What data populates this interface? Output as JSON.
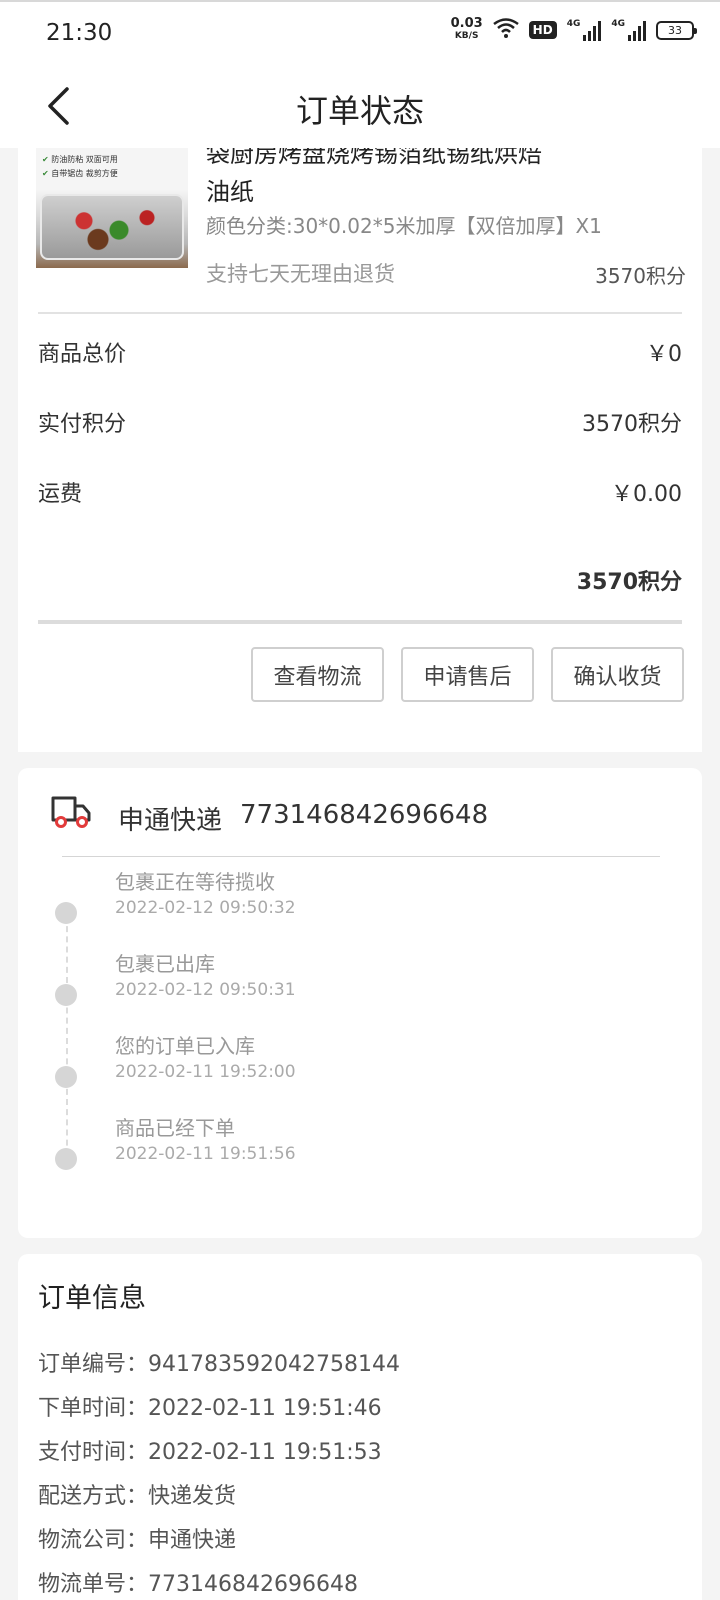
{
  "status_bar": {
    "time": "21:30",
    "speed_value": "0.03",
    "speed_unit": "KB/S",
    "hd": "HD",
    "net1": "4G",
    "net2": "4G",
    "battery": "33"
  },
  "header": {
    "title": "订单状态"
  },
  "product": {
    "name_line1": "袋厨房烤盘烧烤锡箔纸锡纸烘焙",
    "name_line2": "油纸",
    "spec": "颜色分类:30*0.02*5米加厚【双倍加厚】X1",
    "return_policy": "支持七天无理由退货",
    "points": "3570积分",
    "image_features": [
      "防油防粘 双面可用",
      "自带锯齿 裁剪方便"
    ]
  },
  "summary": {
    "goods_total_label": "商品总价",
    "goods_total_value": "￥0",
    "paid_points_label": "实付积分",
    "paid_points_value": "3570积分",
    "shipping_label": "运费",
    "shipping_value": "￥0.00",
    "total": "3570积分"
  },
  "actions": {
    "logistics": "查看物流",
    "after_sale": "申请售后",
    "confirm": "确认收货"
  },
  "logistics": {
    "company": "申通快递",
    "number": "773146842696648",
    "events": [
      {
        "text": "包裹正在等待揽收",
        "time": "2022-02-12 09:50:32"
      },
      {
        "text": "包裹已出库",
        "time": "2022-02-12 09:50:31"
      },
      {
        "text": "您的订单已入库",
        "time": "2022-02-11 19:52:00"
      },
      {
        "text": "商品已经下单",
        "time": "2022-02-11 19:51:56"
      }
    ]
  },
  "order_info": {
    "title": "订单信息",
    "rows": [
      {
        "label": "订单编号：",
        "value": "941783592042758144"
      },
      {
        "label": "下单时间：",
        "value": "2022-02-11 19:51:46"
      },
      {
        "label": "支付时间：",
        "value": "2022-02-11 19:51:53"
      },
      {
        "label": "配送方式：",
        "value": "快递发货"
      },
      {
        "label": "物流公司：",
        "value": "申通快递"
      },
      {
        "label": "物流单号：",
        "value": "773146842696648"
      }
    ]
  },
  "colors": {
    "background": "#f4f4f4",
    "card": "#ffffff",
    "truck_accent": "#e23b3b"
  },
  "icons": [
    "back-arrow-icon",
    "wifi-icon",
    "signal-icon",
    "battery-icon",
    "truck-icon"
  ]
}
